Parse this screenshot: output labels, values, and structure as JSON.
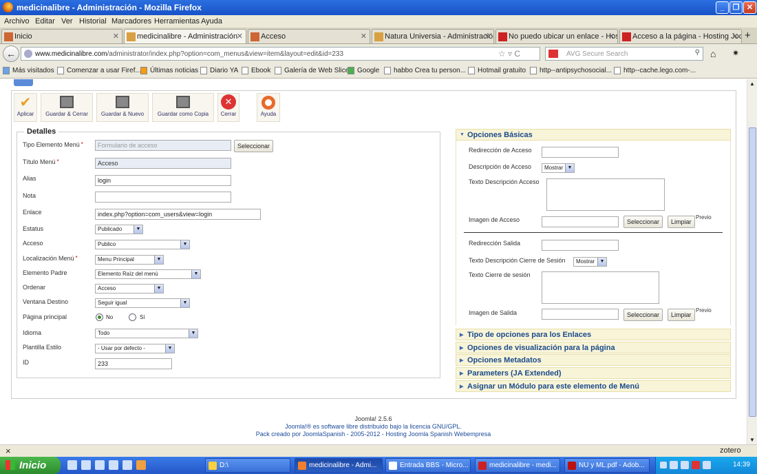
{
  "window": {
    "title": "medicinalibre - Administración - Mozilla Firefox"
  },
  "menu": [
    "Archivo",
    "Editar",
    "Ver",
    "Historial",
    "Marcadores",
    "Herramientas",
    "Ayuda"
  ],
  "tabs": [
    {
      "label": "Inicio",
      "icon": "joomla-icon"
    },
    {
      "label": "medicinalibre - Administración",
      "icon": "tools-icon"
    },
    {
      "label": "Acceso",
      "icon": "joomla-icon"
    },
    {
      "label": "Natura Universia - Administración",
      "icon": "tools-icon"
    },
    {
      "label": "No puedo ubicar un enlace - Hos...",
      "icon": "webempresa-icon"
    },
    {
      "label": "Acceso a la página - Hosting Joo...",
      "icon": "webempresa-icon"
    }
  ],
  "nav": {
    "url_host": "www.medicinalibre.com",
    "url_path": "/administrator/index.php?option=com_menus&view=item&layout=edit&id=233",
    "search_placeholder": "AVG Secure Search"
  },
  "bookmarks": [
    "Más visitados",
    "Comenzar a usar Firef...",
    "Últimas noticias",
    "Diario YA",
    "Ebook",
    "Galería de Web Slice",
    "Google",
    "habbo Crea tu person...",
    "Hotmail gratuito",
    "http--antipsychosocial...",
    "http--cache.lego.com-..."
  ],
  "toolbar": {
    "apply": "Aplicar",
    "save_close": "Guardar & Cerrar",
    "save_new": "Guardar & Nuevo",
    "save_copy": "Guardar como Copia",
    "close": "Cerrar",
    "help": "Ayuda"
  },
  "details": {
    "legend": "Detalles",
    "type_label": "Tipo Elemento Menú",
    "type_placeholder": "Formulario de acceso",
    "select_btn": "Seleccionar",
    "title_label": "Título Menú",
    "title_value": "Acceso",
    "alias_label": "Alias",
    "alias_value": "login",
    "note_label": "Nota",
    "note_value": "",
    "link_label": "Enlace",
    "link_value": "index.php?option=com_users&view=login",
    "status_label": "Estatus",
    "status_value": "Publicado",
    "access_label": "Acceso",
    "access_value": "Publico",
    "menu_loc_label": "Localización Menú",
    "menu_loc_value": "Menu Principal",
    "parent_label": "Elemento Padre",
    "parent_value": "Elemento Raíz del menú",
    "order_label": "Ordenar",
    "order_value": "Acceso",
    "target_label": "Ventana Destino",
    "target_value": "Seguir igual",
    "home_label": "Página principal",
    "home_no": "No",
    "home_yes": "Sí",
    "lang_label": "Idioma",
    "lang_value": "Todo",
    "template_label": "Plantilla Estilo",
    "template_value": "- Usar por defecto -",
    "id_label": "ID",
    "id_value": "233",
    "required_mark": "*"
  },
  "basic": {
    "header": "Opciones Básicas",
    "login_redirect": "Redirección de Acceso",
    "login_desc": "Descripción de Acceso",
    "login_desc_value": "Mostrar",
    "login_desc_text": "Texto Descripción Acceso",
    "login_image": "Imagen de Acceso",
    "select": "Seleccionar",
    "clear": "Limpiar",
    "preview": "Previo",
    "logout_redirect": "Redirección Salida",
    "logout_desc": "Texto Descripción Cierre de Sesión",
    "logout_desc_value": "Mostrar",
    "logout_text": "Texto Cierre de sesión",
    "logout_image": "Imagen de Salida"
  },
  "accordions": [
    "Tipo de opciones para los Enlaces",
    "Opciones de visualización para la página",
    "Opciones Metadatos",
    "Parameters (JA Extended)",
    "Asignar un Módulo para este elemento de Menú"
  ],
  "footer": {
    "version": "Joomla! 2.5.6",
    "license": "Joomla!® es software libre distribuido bajo la licencia GNU/GPL.",
    "pack": "Pack creado por JoomlaSpanish - 2005-2012 - Hosting Joomla Spanish Webempresa"
  },
  "status": {
    "close": "×",
    "addon": "zotero"
  },
  "taskbar": {
    "start": "Inicio",
    "items": [
      "D:\\",
      "medicinalibre - Admi...",
      "Entrada BBS - Micro...",
      "medicinalibre - medi...",
      "NU y ML.pdf - Adob..."
    ],
    "clock": "14:39"
  }
}
